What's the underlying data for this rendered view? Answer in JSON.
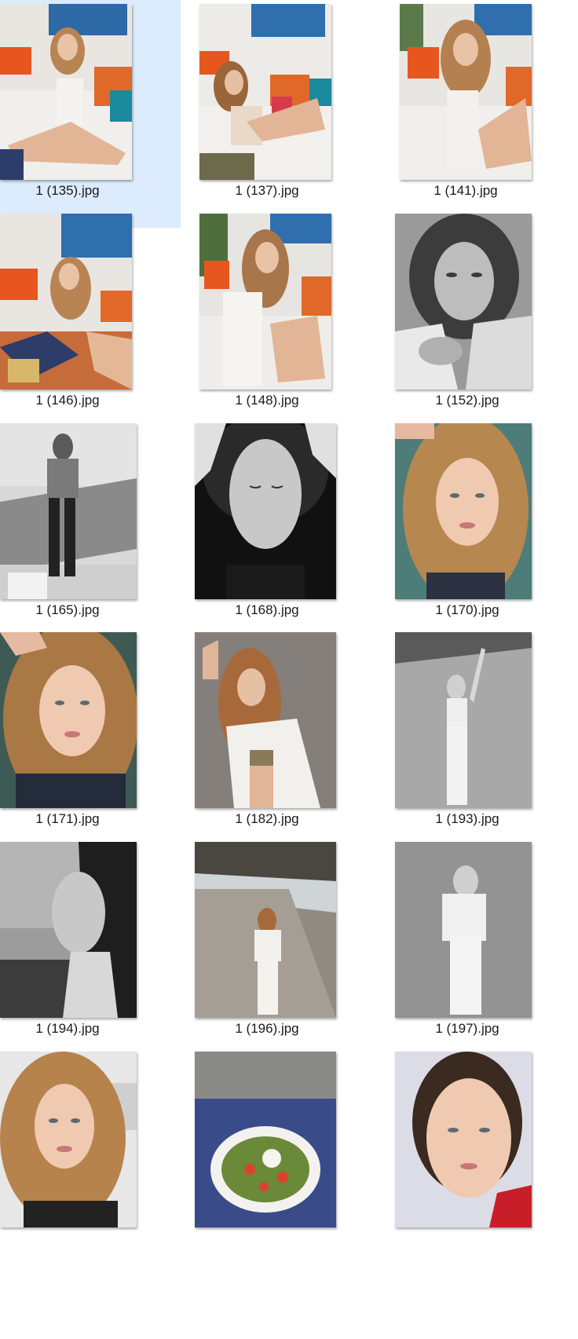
{
  "files": [
    {
      "name": "1 (135).jpg",
      "scene": "bw-false",
      "selected": true
    },
    {
      "name": "1 (137).jpg",
      "scene": "color"
    },
    {
      "name": "1 (141).jpg",
      "scene": "color"
    },
    {
      "name": "1 (146).jpg",
      "scene": "color"
    },
    {
      "name": "1 (148).jpg",
      "scene": "color"
    },
    {
      "name": "1 (152).jpg",
      "scene": "bw"
    },
    {
      "name": "1 (165).jpg",
      "scene": "bw"
    },
    {
      "name": "1 (168).jpg",
      "scene": "bw"
    },
    {
      "name": "1 (170).jpg",
      "scene": "color"
    },
    {
      "name": "1 (171).jpg",
      "scene": "color"
    },
    {
      "name": "1 (182).jpg",
      "scene": "color"
    },
    {
      "name": "1 (193).jpg",
      "scene": "bw"
    },
    {
      "name": "1 (194).jpg",
      "scene": "bw"
    },
    {
      "name": "1 (196).jpg",
      "scene": "color"
    },
    {
      "name": "1 (197).jpg",
      "scene": "bw"
    },
    {
      "name": "",
      "scene": "color"
    },
    {
      "name": "",
      "scene": "color"
    },
    {
      "name": "",
      "scene": "color"
    }
  ],
  "colors": {
    "selection": "#dcecfc",
    "label_text": "#1a1a1a"
  }
}
